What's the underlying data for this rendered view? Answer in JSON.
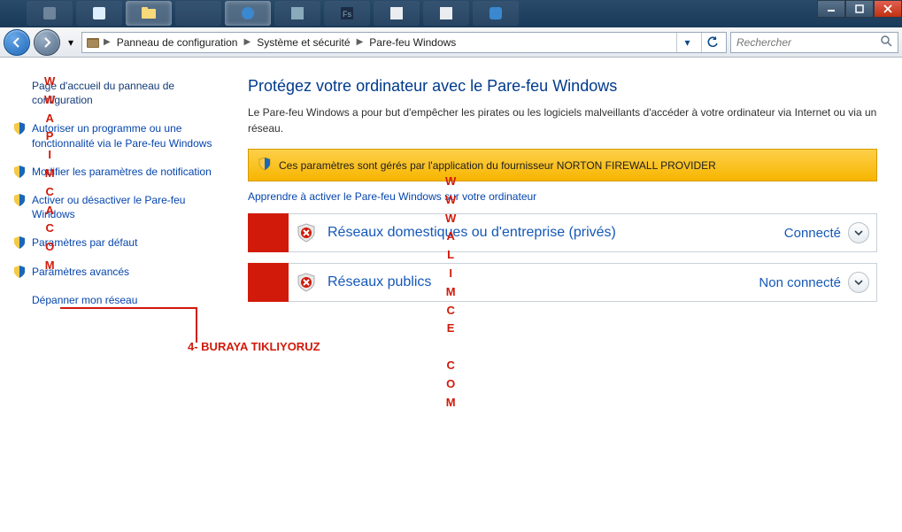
{
  "breadcrumb": {
    "items": [
      "Panneau de configuration",
      "Système et sécurité",
      "Pare-feu Windows"
    ]
  },
  "search": {
    "placeholder": "Rechercher"
  },
  "sidebar": {
    "home": "Page d'accueil du panneau de configuration",
    "items": [
      "Autoriser un programme ou une fonctionnalité via le Pare-feu Windows",
      "Modifier les paramètres de notification",
      "Activer ou désactiver le Pare-feu Windows",
      "Paramètres par défaut",
      "Paramètres avancés",
      "Dépanner mon réseau"
    ]
  },
  "content": {
    "title": "Protégez votre ordinateur avec le Pare-feu Windows",
    "description": "Le Pare-feu Windows a pour but d'empêcher les pirates ou les logiciels malveillants d'accéder à votre ordinateur via Internet ou via un réseau.",
    "alert": "Ces paramètres sont gérés par l'application du fournisseur NORTON FIREWALL PROVIDER",
    "learn_link": "Apprendre à activer le Pare-feu Windows sur votre ordinateur",
    "networks": [
      {
        "label": "Réseaux domestiques ou d'entreprise (privés)",
        "status": "Connecté",
        "color": "#d11a0a"
      },
      {
        "label": "Réseaux publics",
        "status": "Non connecté",
        "color": "#d11a0a"
      }
    ]
  },
  "annotation": {
    "callout": "4- BURAYA TIKLIYORUZ",
    "watermark_left": "W\nW\nA\nP\nI\nM\nC\nA\nC\nO\nM",
    "watermark_center": "W\nW\nW\nA\nL\nI\nM\nC\nE\n \nC\nO\nM"
  }
}
